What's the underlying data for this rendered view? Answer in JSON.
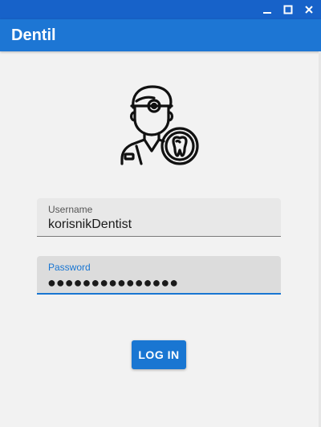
{
  "window": {
    "controls": {
      "minimize": "—",
      "maximize": "☐",
      "close": "✕"
    }
  },
  "app": {
    "title": "Dentil"
  },
  "logo": {
    "icon": "dentist-with-tooth-icon"
  },
  "form": {
    "username": {
      "label": "Username",
      "value": "korisnikDentist"
    },
    "password": {
      "label": "Password",
      "masked_value": "●●●●●●●●●●●●●●●"
    },
    "login_label": "LOG IN"
  },
  "colors": {
    "titlebar": "#1762c9",
    "appbar": "#1d76d4",
    "accent": "#1976d2",
    "background": "#f2f2f2"
  }
}
